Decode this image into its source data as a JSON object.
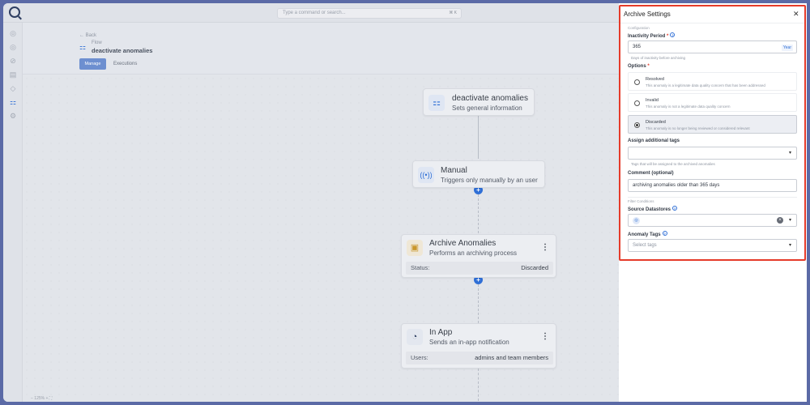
{
  "topbar": {
    "command_placeholder": "Type a command or search...",
    "shortcut": "⌘ K"
  },
  "header": {
    "back_label": "Back",
    "flow_label": "Flow",
    "flow_name": "deactivate anomalies",
    "tabs": [
      {
        "label": "Manage",
        "active": true
      },
      {
        "label": "Executions",
        "active": false
      }
    ]
  },
  "sidebar": {
    "icons": [
      "database-icon",
      "database-icon",
      "check-circle-icon",
      "clipboard-icon",
      "tag-icon",
      "flow-icon",
      "gear-icon"
    ],
    "active_index": 5
  },
  "canvas": {
    "nodes": [
      {
        "id": "flow",
        "title": "deactivate anomalies",
        "subtitle": "Sets general information",
        "icon": "flow-icon"
      },
      {
        "id": "manual",
        "title": "Manual",
        "subtitle": "Triggers only manually by an user",
        "icon": "broadcast-icon"
      },
      {
        "id": "archive",
        "title": "Archive Anomalies",
        "subtitle": "Performs an archiving process",
        "icon": "archive-icon",
        "row_key": "Status:",
        "row_value": "Discarded"
      },
      {
        "id": "inapp",
        "title": "In App",
        "subtitle": "Sends an in-app notification",
        "icon": "app-logo-icon",
        "row_key": "Users:",
        "row_value": "admins and team members"
      }
    ],
    "zoom_label": "− 125% + ⛶"
  },
  "panel": {
    "title": "Archive Settings",
    "configuration_label": "Configuration",
    "inactivity": {
      "label": "Inactivity Period",
      "value": "365",
      "unit": "Year",
      "hint": "Days of inactivity before archiving"
    },
    "options": {
      "label": "Options",
      "items": [
        {
          "title": "Resolved",
          "desc": "This anomaly is a legitimate data quality concern that has been addressed",
          "selected": false
        },
        {
          "title": "Invalid",
          "desc": "This anomaly is not a legitimate data quality concern",
          "selected": false
        },
        {
          "title": "Discarded",
          "desc": "This anomaly is no longer being reviewed or considered relevant",
          "selected": true
        }
      ]
    },
    "tags": {
      "label": "Assign additional tags",
      "hint": "Tags that will be assigned to the archived anomalies"
    },
    "comment": {
      "label": "Comment (optional)",
      "value": "archiving anomalies older than 365 days"
    },
    "filter_label": "Filter Conditions",
    "source": {
      "label": "Source Datastores"
    },
    "anomaly_tags": {
      "label": "Anomaly Tags",
      "placeholder": "Select tags"
    }
  }
}
